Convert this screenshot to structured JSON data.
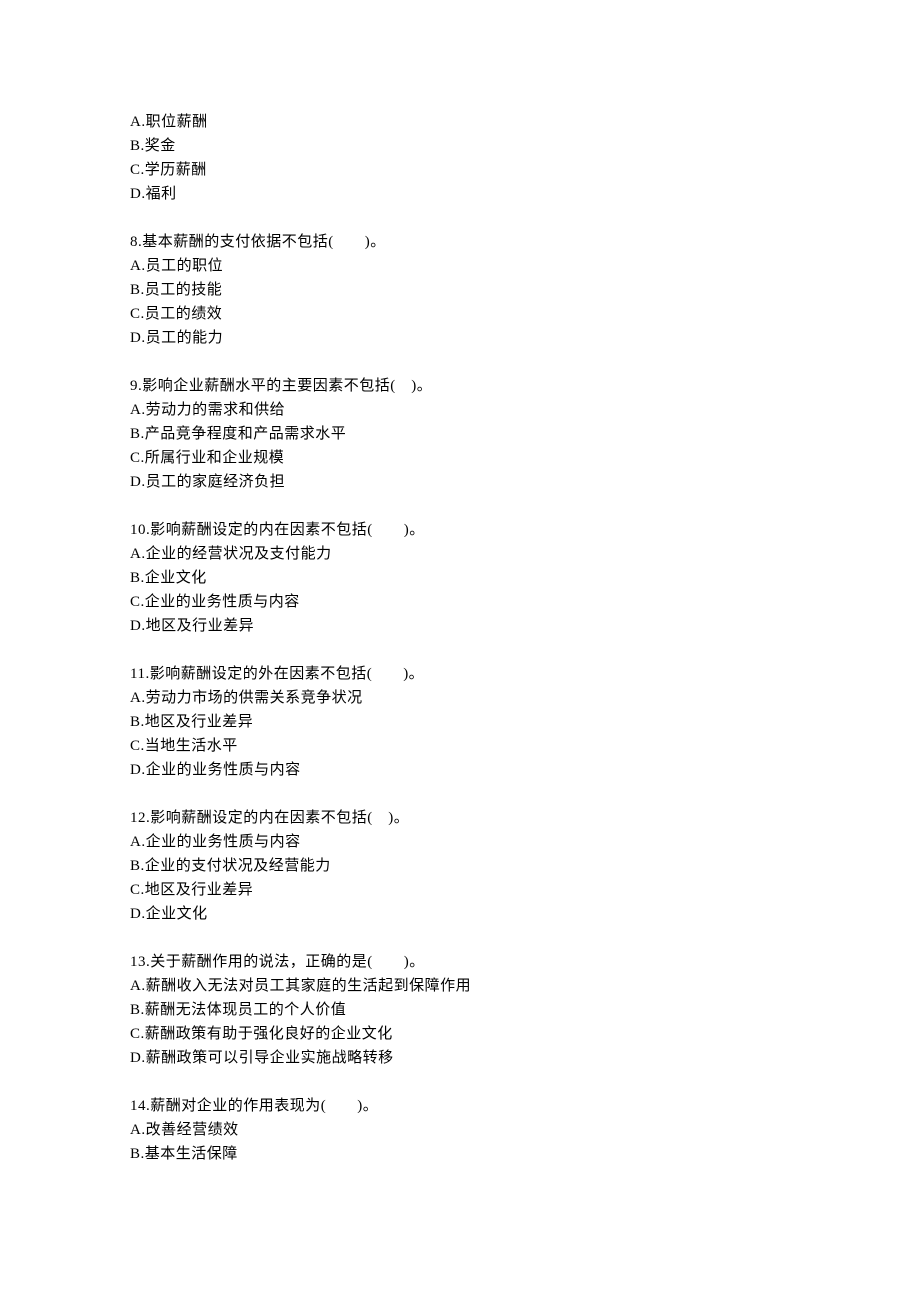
{
  "topOptions": [
    "A.职位薪酬",
    "B.奖金",
    "C.学历薪酬",
    "D.福利"
  ],
  "questions": [
    {
      "stem": "8.基本薪酬的支付依据不包括(　　)。",
      "options": [
        "A.员工的职位",
        "B.员工的技能",
        "C.员工的绩效",
        "D.员工的能力"
      ]
    },
    {
      "stem": "9.影响企业薪酬水平的主要因素不包括(　)。",
      "options": [
        "A.劳动力的需求和供给",
        "B.产品竞争程度和产品需求水平",
        "C.所属行业和企业规模",
        "D.员工的家庭经济负担"
      ]
    },
    {
      "stem": "10.影响薪酬设定的内在因素不包括(　　)。",
      "options": [
        "A.企业的经营状况及支付能力",
        "B.企业文化",
        "C.企业的业务性质与内容",
        "D.地区及行业差异"
      ]
    },
    {
      "stem": "11.影响薪酬设定的外在因素不包括(　　)。",
      "options": [
        "A.劳动力市场的供需关系竞争状况",
        "B.地区及行业差异",
        "C.当地生活水平",
        "D.企业的业务性质与内容"
      ]
    },
    {
      "stem": "12.影响薪酬设定的内在因素不包括(　)。",
      "options": [
        "A.企业的业务性质与内容",
        "B.企业的支付状况及经营能力",
        "C.地区及行业差异",
        "D.企业文化"
      ]
    },
    {
      "stem": "13.关于薪酬作用的说法，正确的是(　　)。",
      "options": [
        "A.薪酬收入无法对员工其家庭的生活起到保障作用",
        "B.薪酬无法体现员工的个人价值",
        "C.薪酬政策有助于强化良好的企业文化",
        "D.薪酬政策可以引导企业实施战略转移"
      ]
    },
    {
      "stem": "14.薪酬对企业的作用表现为(　　)。",
      "options": [
        "A.改善经营绩效",
        "B.基本生活保障"
      ]
    }
  ]
}
